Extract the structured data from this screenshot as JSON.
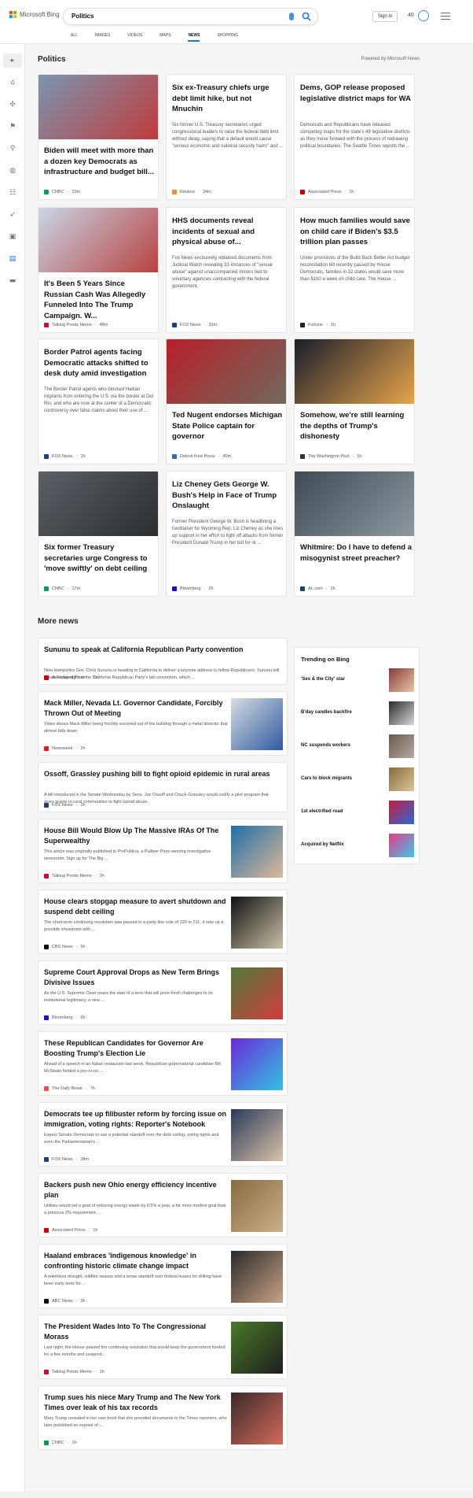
{
  "header": {
    "logo_text": "Microsoft Bing",
    "query": "Politics",
    "tabs": [
      "ALL",
      "IMAGES",
      "VIDEOS",
      "MAPS",
      "NEWS",
      "SHOPPING"
    ],
    "active_tab": "NEWS",
    "signin_label": "Sign in",
    "reward_points": "40"
  },
  "section": {
    "title": "Politics",
    "powered_by": "Powered by Microsoft News"
  },
  "cards": [
    {
      "title": "Biden will meet with more than a dozen key Democrats as infrastructure and budget bill...",
      "snippet": "",
      "source": "CNBC",
      "age": "23m",
      "src_color": "#0a9c4a",
      "img_colors": [
        "#7a95b0",
        "#c03b3b"
      ]
    },
    {
      "title": "Six ex-Treasury chiefs urge debt limit hike, but not Mnuchin",
      "snippet": "Six former U.S. Treasury secretaries urged congressional leaders to raise the federal debt limit without delay, saying that a default would cause \"serious economic and national security harm\" and ...",
      "source": "Reuters",
      "age": "34m",
      "src_color": "#f29121"
    },
    {
      "title": "Dems, GOP release proposed legislative district maps for WA",
      "snippet": "Democrats and Republicans have released competing maps for the state's 49 legislative districts as they move forward with the process of redrawing political boundaries. The Seattle Times reports the ...",
      "source": "Associated Press",
      "age": "1h",
      "src_color": "#cc0000"
    },
    {
      "title": "It's Been 5 Years Since Russian Cash Was Allegedly Funneled Into The Trump Campaign. W...",
      "snippet": "",
      "source": "Talking Points Memo",
      "age": "48m",
      "src_color": "#c8102e",
      "img_colors": [
        "#c9d6e6",
        "#b8413f"
      ]
    },
    {
      "title": "HHS documents reveal incidents of sexual and physical abuse of...",
      "snippet": "Fox News exclusively obtained documents from Judicial Watch revealing 33 instances of \"sexual abuse\" against unaccompanied minors tied to voluntary agencies contracting with the federal government.",
      "source": "FOX News",
      "age": "32m",
      "src_color": "#1d3f8c"
    },
    {
      "title": "How much families would save on child care if Biden's $3.5 trillion plan passes",
      "snippet": "Under provisions of the Build Back Better Act budget reconciliation bill recently passed by House Democrats, families in 32 states would save more than $100 a week on child care. The House ...",
      "source": "Fortune",
      "age": "1h",
      "src_color": "#222222"
    },
    {
      "title": "Border Patrol agents facing Democratic attacks shifted to desk duty amid investigation",
      "snippet": "The Border Patrol agents who blocked Haitian migrants from entering the U.S. via the border at Del Rio, and who are now at the center of a Democratic controversy over false claims about their use of ...",
      "source": "FOX News",
      "age": "1h",
      "src_color": "#1d3f8c"
    },
    {
      "title": "Ted Nugent endorses Michigan State Police captain for governor",
      "snippet": "",
      "source": "Detroit Free Press",
      "age": "40m",
      "src_color": "#2a6ebb",
      "img_colors": [
        "#b81f2a",
        "#6f6a5c"
      ]
    },
    {
      "title": "Somehow, we're still learning the depths of Trump's dishonesty",
      "snippet": "",
      "source": "The Washington Post",
      "age": "1h",
      "src_color": "#333333",
      "img_colors": [
        "#1a1d2b",
        "#e8a64a"
      ]
    },
    {
      "title": "Six former Treasury secretaries urge Congress to 'move swiftly' on debt ceiling",
      "snippet": "",
      "source": "CNBC",
      "age": "17m",
      "src_color": "#0a9c4a",
      "img_colors": [
        "#5a6066",
        "#2b2e30"
      ]
    },
    {
      "title": "Liz Cheney Gets George W. Bush's Help in Face of Trump Onslaught",
      "snippet": "Former President George W. Bush is headlining a fundraiser for Wyoming Rep. Liz Cheney as she lines up support in her effort to fight off attacks from former President Donald Trump in her bid for re ...",
      "source": "Bloomberg",
      "age": "2h",
      "src_color": "#2800d7"
    },
    {
      "title": "Whitmire: Do I have to defend a misogynist street preacher?",
      "snippet": "",
      "source": "AL.com",
      "age": "1h",
      "src_color": "#1c3f6e",
      "img_colors": [
        "#3e4a55",
        "#8e9aa0"
      ]
    }
  ],
  "more_news": {
    "title": "More news",
    "items": [
      {
        "title": "Sununu to speak at California Republican Party convention",
        "snippet": "New Hampshire Gov. Chris Sununu is heading to California to deliver a keynote address to fellow Republicans. Sununu will speak Friday night at the California Republican Party's fall convention, which ...",
        "source": "Associated Press",
        "age": "1h",
        "src_color": "#cc0000"
      },
      {
        "title": "Mack Miller, Nevada Lt. Governor Candidate, Forcibly Thrown Out of Meeting",
        "snippet": "Video shows Mack Miller being forcibly escorted out of the building through a metal detector that almost falls down.",
        "source": "Newsweek",
        "age": "2h",
        "src_color": "#e01b22",
        "thumb_colors": [
          "#d8dde2",
          "#2d5aa0"
        ]
      },
      {
        "title": "Ossoff, Grassley pushing bill to fight opioid epidemic in rural areas",
        "snippet": "A bill introduced in the Senate Wednesday by Sens. Jon Ossoff and Chuck Grassley would codify a pilot program that gives grants to rural communities to fight opioid abuse.",
        "source": "FOX News",
        "age": "2h",
        "src_color": "#1d3f8c"
      },
      {
        "title": "House Bill Would Blow Up The Massive IRAs Of The Superwealthy",
        "snippet": "This article was originally published in ProPublica, a Pulitzer Prize-winning investigative newsroom. Sign up for The Big ...",
        "source": "Talking Points Memo",
        "age": "2h",
        "src_color": "#c8102e",
        "thumb_colors": [
          "#1e6fa8",
          "#e0b89a"
        ]
      },
      {
        "title": "House clears stopgap measure to avert shutdown and suspend debt ceiling",
        "snippet": "The short-term continuing resolution was passed in a party-line vote of 220 to 211. It sets up a possible showdown with ...",
        "source": "CBS News",
        "age": "5h",
        "src_color": "#111111",
        "thumb_colors": [
          "#111111",
          "#c9c1a8"
        ]
      },
      {
        "title": "Supreme Court Approval Drops as New Term Brings Divisive Issues",
        "snippet": "As the U.S. Supreme Court nears the start of a term that will pose fresh challenges to its institutional legitimacy, a new ...",
        "source": "Bloomberg",
        "age": "6h",
        "src_color": "#2800d7",
        "thumb_colors": [
          "#4f7a3a",
          "#d13b3b"
        ]
      },
      {
        "title": "These Republican Candidates for Governor Are Boosting Trump's Election Lie",
        "snippet": "Ahead of a speech in an Italian restaurant last week, Republican gubernatorial candidate Bill McSwain fielded a yes-or-no ...",
        "source": "The Daily Beast",
        "age": "7h",
        "src_color": "#ee4d4d",
        "thumb_colors": [
          "#6a2ad9",
          "#31c3e0"
        ]
      },
      {
        "title": "Democrats tee up filibuster reform by forcing issue on immigration, voting rights: Reporter's Notebook",
        "snippet": "Expect Senate Democrats to use a potential standoff over the debt ceiling, voting rights and even the Parliamentarian's ...",
        "source": "FOX News",
        "age": "38m",
        "src_color": "#1d3f8c",
        "thumb_colors": [
          "#2a3a5a",
          "#d9c3a8"
        ]
      },
      {
        "title": "Backers push new Ohio energy efficiency incentive plan",
        "snippet": "Utilities would set a goal of reducing energy waste by 0.5% a year, a far more modest goal than a previous 2% requirement, ...",
        "source": "Associated Press",
        "age": "1h",
        "src_color": "#cc0000",
        "thumb_colors": [
          "#8a6a40",
          "#c9b08a"
        ]
      },
      {
        "title": "Haaland embraces 'indigenous knowledge' in confronting historic climate change impact",
        "snippet": "A relentless drought, wildfire season and a tense standoff over federal leases for drilling have been early tests for ...",
        "source": "ABC News",
        "age": "3h",
        "src_color": "#111111",
        "thumb_colors": [
          "#2a2a2a",
          "#c9a184"
        ]
      },
      {
        "title": "The President Wades Into To The Congressional Morass",
        "snippet": "Last night, the House passed the continuing resolution that would keep the government funded for a few months and suspend...",
        "source": "Talking Points Memo",
        "age": "1h",
        "src_color": "#c8102e",
        "thumb_colors": [
          "#4a7a2a",
          "#1d1d1d"
        ]
      },
      {
        "title": "Trump sues his niece Mary Trump and The New York Times over leak of his tax records",
        "snippet": "Mary Trump revealed in her own book that she provided documents to the Times reporters, who later published an exposé of ...",
        "source": "CNBC",
        "age": "1h",
        "src_color": "#0a9c4a",
        "thumb_colors": [
          "#3a2a2a",
          "#d46a5a"
        ]
      }
    ]
  },
  "trending": {
    "title": "Trending on Bing",
    "items": [
      {
        "label": "'Sex & the City' star",
        "thumb_colors": [
          "#8a3a3a",
          "#e8c8a8"
        ]
      },
      {
        "label": "B'day candles backfire",
        "thumb_colors": [
          "#2a2a2a",
          "#d8d8d8"
        ]
      },
      {
        "label": "NC suspends workers",
        "thumb_colors": [
          "#6a5a4a",
          "#b8a8a8"
        ]
      },
      {
        "label": "Cars to block migrants",
        "thumb_colors": [
          "#8a6a3a",
          "#d8c89a"
        ]
      },
      {
        "label": "1st electrified road",
        "thumb_colors": [
          "#c81a3a",
          "#2a6ad8"
        ]
      },
      {
        "label": "Acquired by Netflix",
        "thumb_colors": [
          "#e83a8a",
          "#3ac8e8"
        ]
      }
    ]
  }
}
